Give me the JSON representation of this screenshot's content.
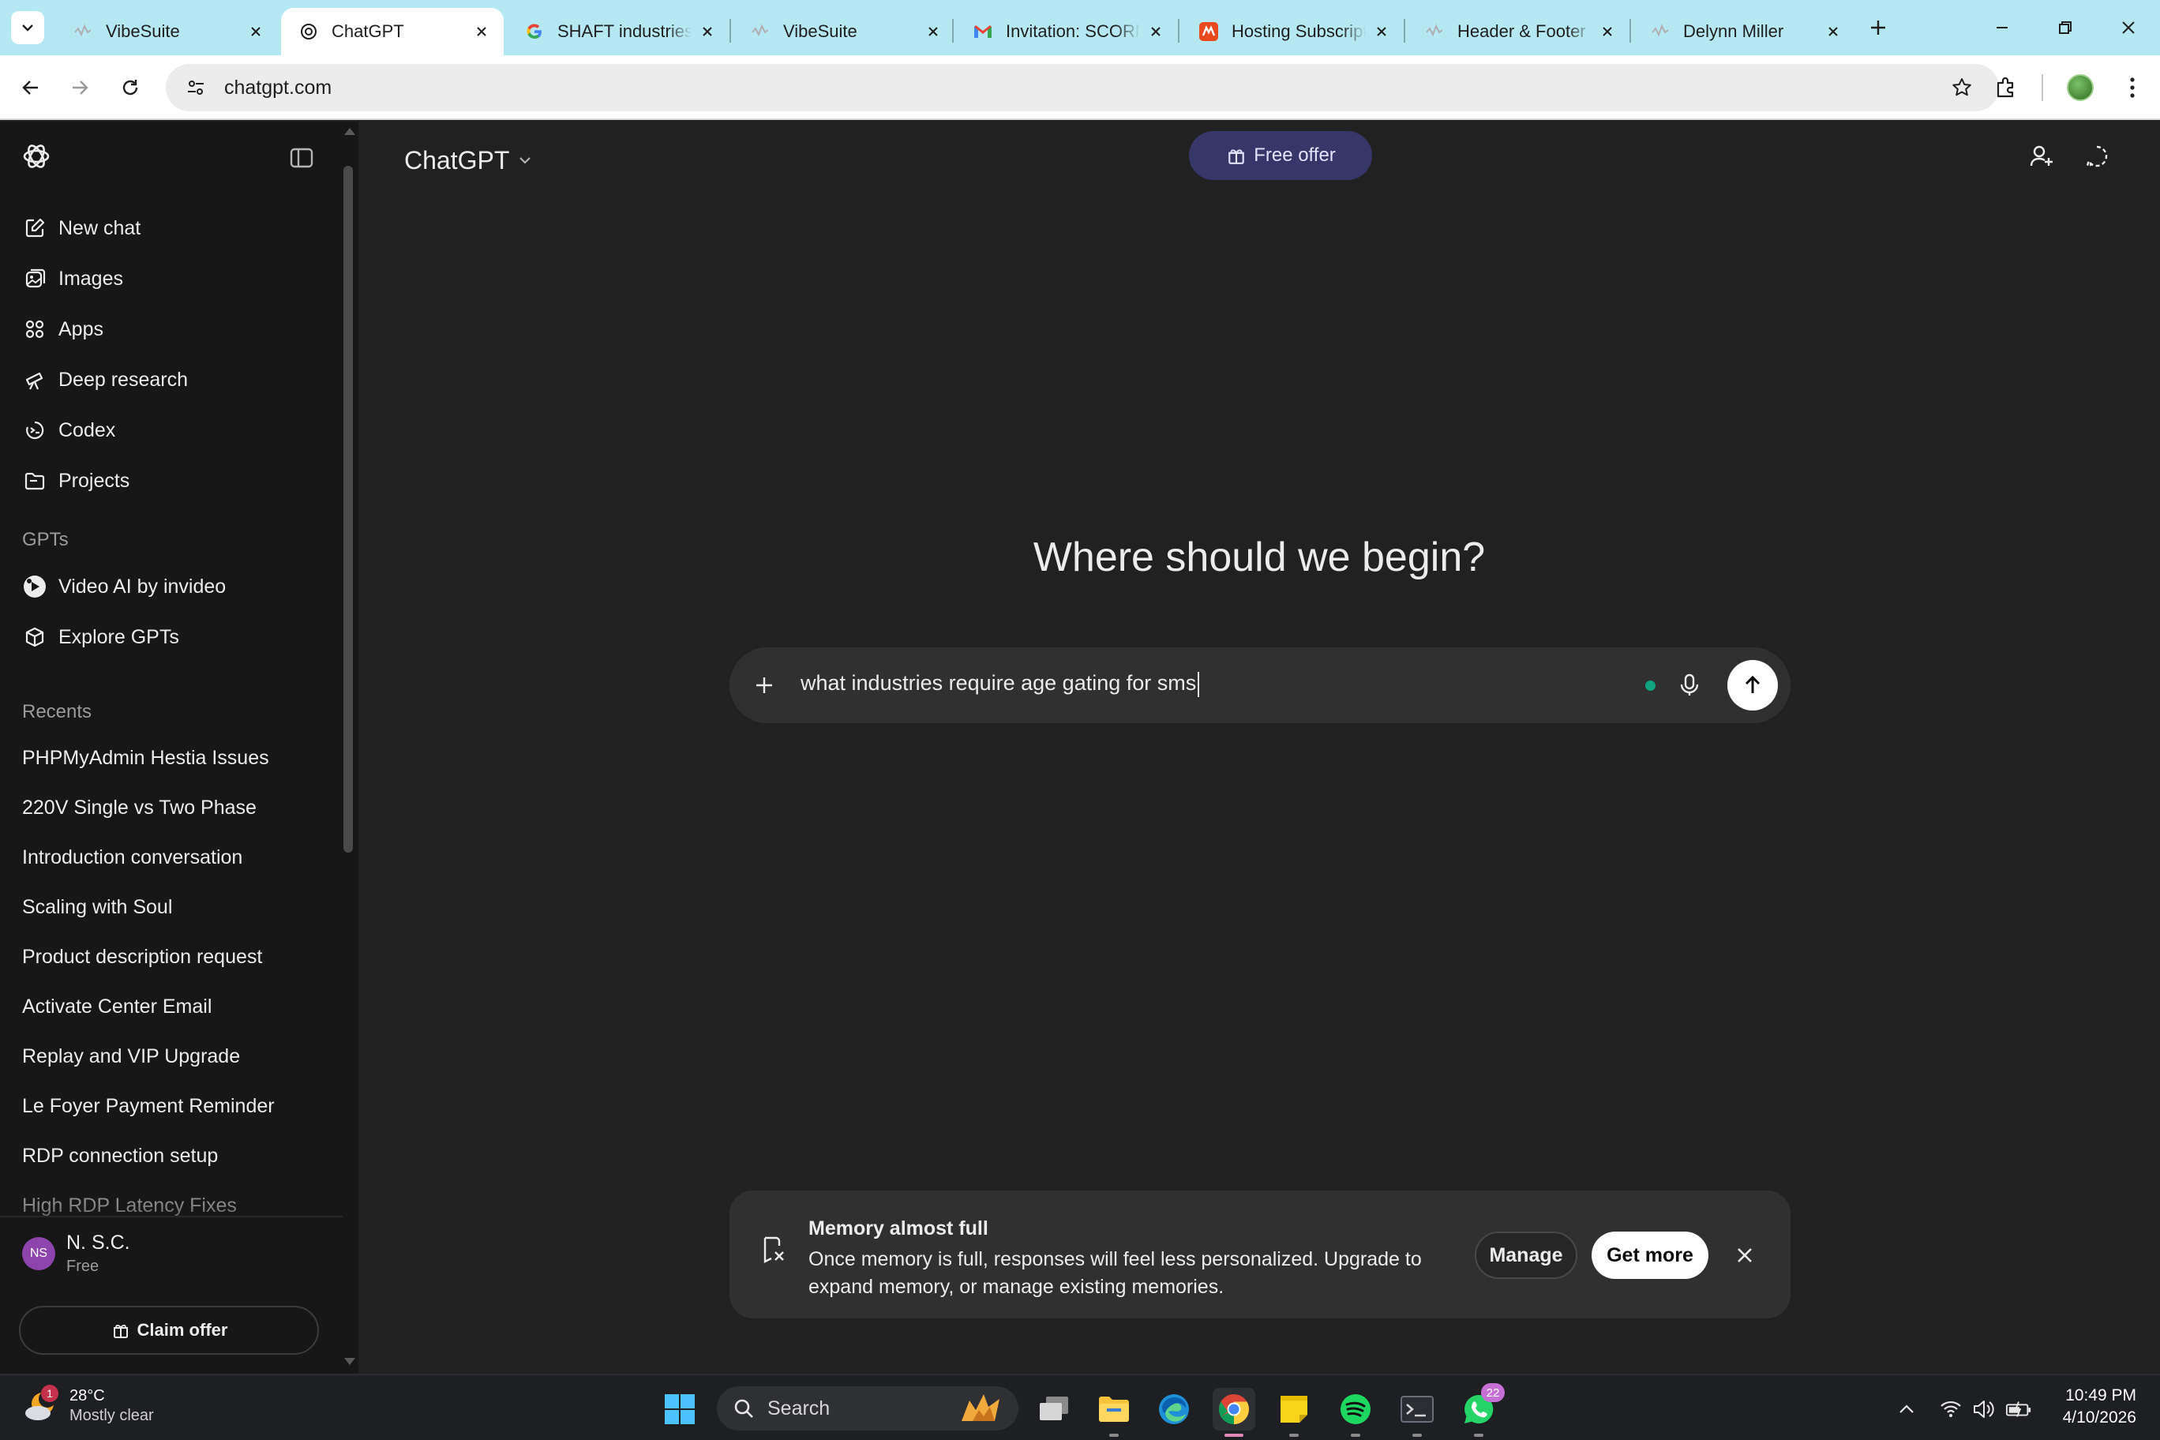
{
  "browser": {
    "tabs": [
      {
        "title": "VibeSuite",
        "icon": "vibesuite-favicon",
        "active": false
      },
      {
        "title": "ChatGPT",
        "icon": "openai-favicon",
        "active": true
      },
      {
        "title": "SHAFT industries",
        "icon": "google-favicon",
        "active": false
      },
      {
        "title": "VibeSuite",
        "icon": "vibesuite-favicon",
        "active": false
      },
      {
        "title": "Invitation: SCORM",
        "icon": "gmail-favicon",
        "active": false
      },
      {
        "title": "Hosting Subscription",
        "icon": "hosting-favicon",
        "active": false
      },
      {
        "title": "Header & Footer",
        "icon": "vibesuite-favicon",
        "active": false
      },
      {
        "title": "Delynn Miller",
        "icon": "vibesuite-favicon",
        "active": false
      }
    ],
    "url": "chatgpt.com"
  },
  "sidebar": {
    "nav": [
      {
        "label": "New chat",
        "icon": "compose-icon"
      },
      {
        "label": "Images",
        "icon": "images-icon"
      },
      {
        "label": "Apps",
        "icon": "apps-grid-icon"
      },
      {
        "label": "Deep research",
        "icon": "telescope-icon"
      },
      {
        "label": "Codex",
        "icon": "codex-icon"
      },
      {
        "label": "Projects",
        "icon": "folder-icon"
      }
    ],
    "gpts_heading": "GPTs",
    "gpts": [
      {
        "label": "Video AI by invideo",
        "icon": "invideo-icon"
      },
      {
        "label": "Explore GPTs",
        "icon": "cube-icon"
      }
    ],
    "recents_heading": "Recents",
    "recents": [
      "PHPMyAdmin Hestia Issues",
      "220V Single vs Two Phase",
      "Introduction conversation",
      "Scaling with Soul",
      "Product description request",
      "Activate Center Email",
      "Replay and VIP Upgrade",
      "Le Foyer Payment Reminder",
      "RDP connection setup",
      "High RDP Latency Fixes"
    ],
    "user": {
      "initials": "NS",
      "name": "N. S.C.",
      "plan": "Free"
    },
    "claim_offer_label": "Claim offer"
  },
  "main": {
    "model_label": "ChatGPT",
    "free_offer_label": "Free offer",
    "hero": "Where should we begin?",
    "composer_text": "what industries require age gating for sms"
  },
  "memory_banner": {
    "title": "Memory almost full",
    "body": "Once memory is full, responses will feel less personalized. Upgrade to expand memory, or manage existing memories.",
    "manage_label": "Manage",
    "get_more_label": "Get more"
  },
  "taskbar": {
    "weather_temp": "28°C",
    "weather_condition": "Mostly clear",
    "weather_badge": "1",
    "search_label": "Search",
    "whatsapp_badge": "22",
    "time": "10:49 PM",
    "date": "4/10/2026"
  },
  "colors": {
    "tabstrip": "#b5e8f3",
    "sidebar_bg": "#171717",
    "main_bg": "#212121",
    "composer_bg": "#303030",
    "free_offer_bg": "#373669",
    "status_dot": "#10a37f"
  }
}
